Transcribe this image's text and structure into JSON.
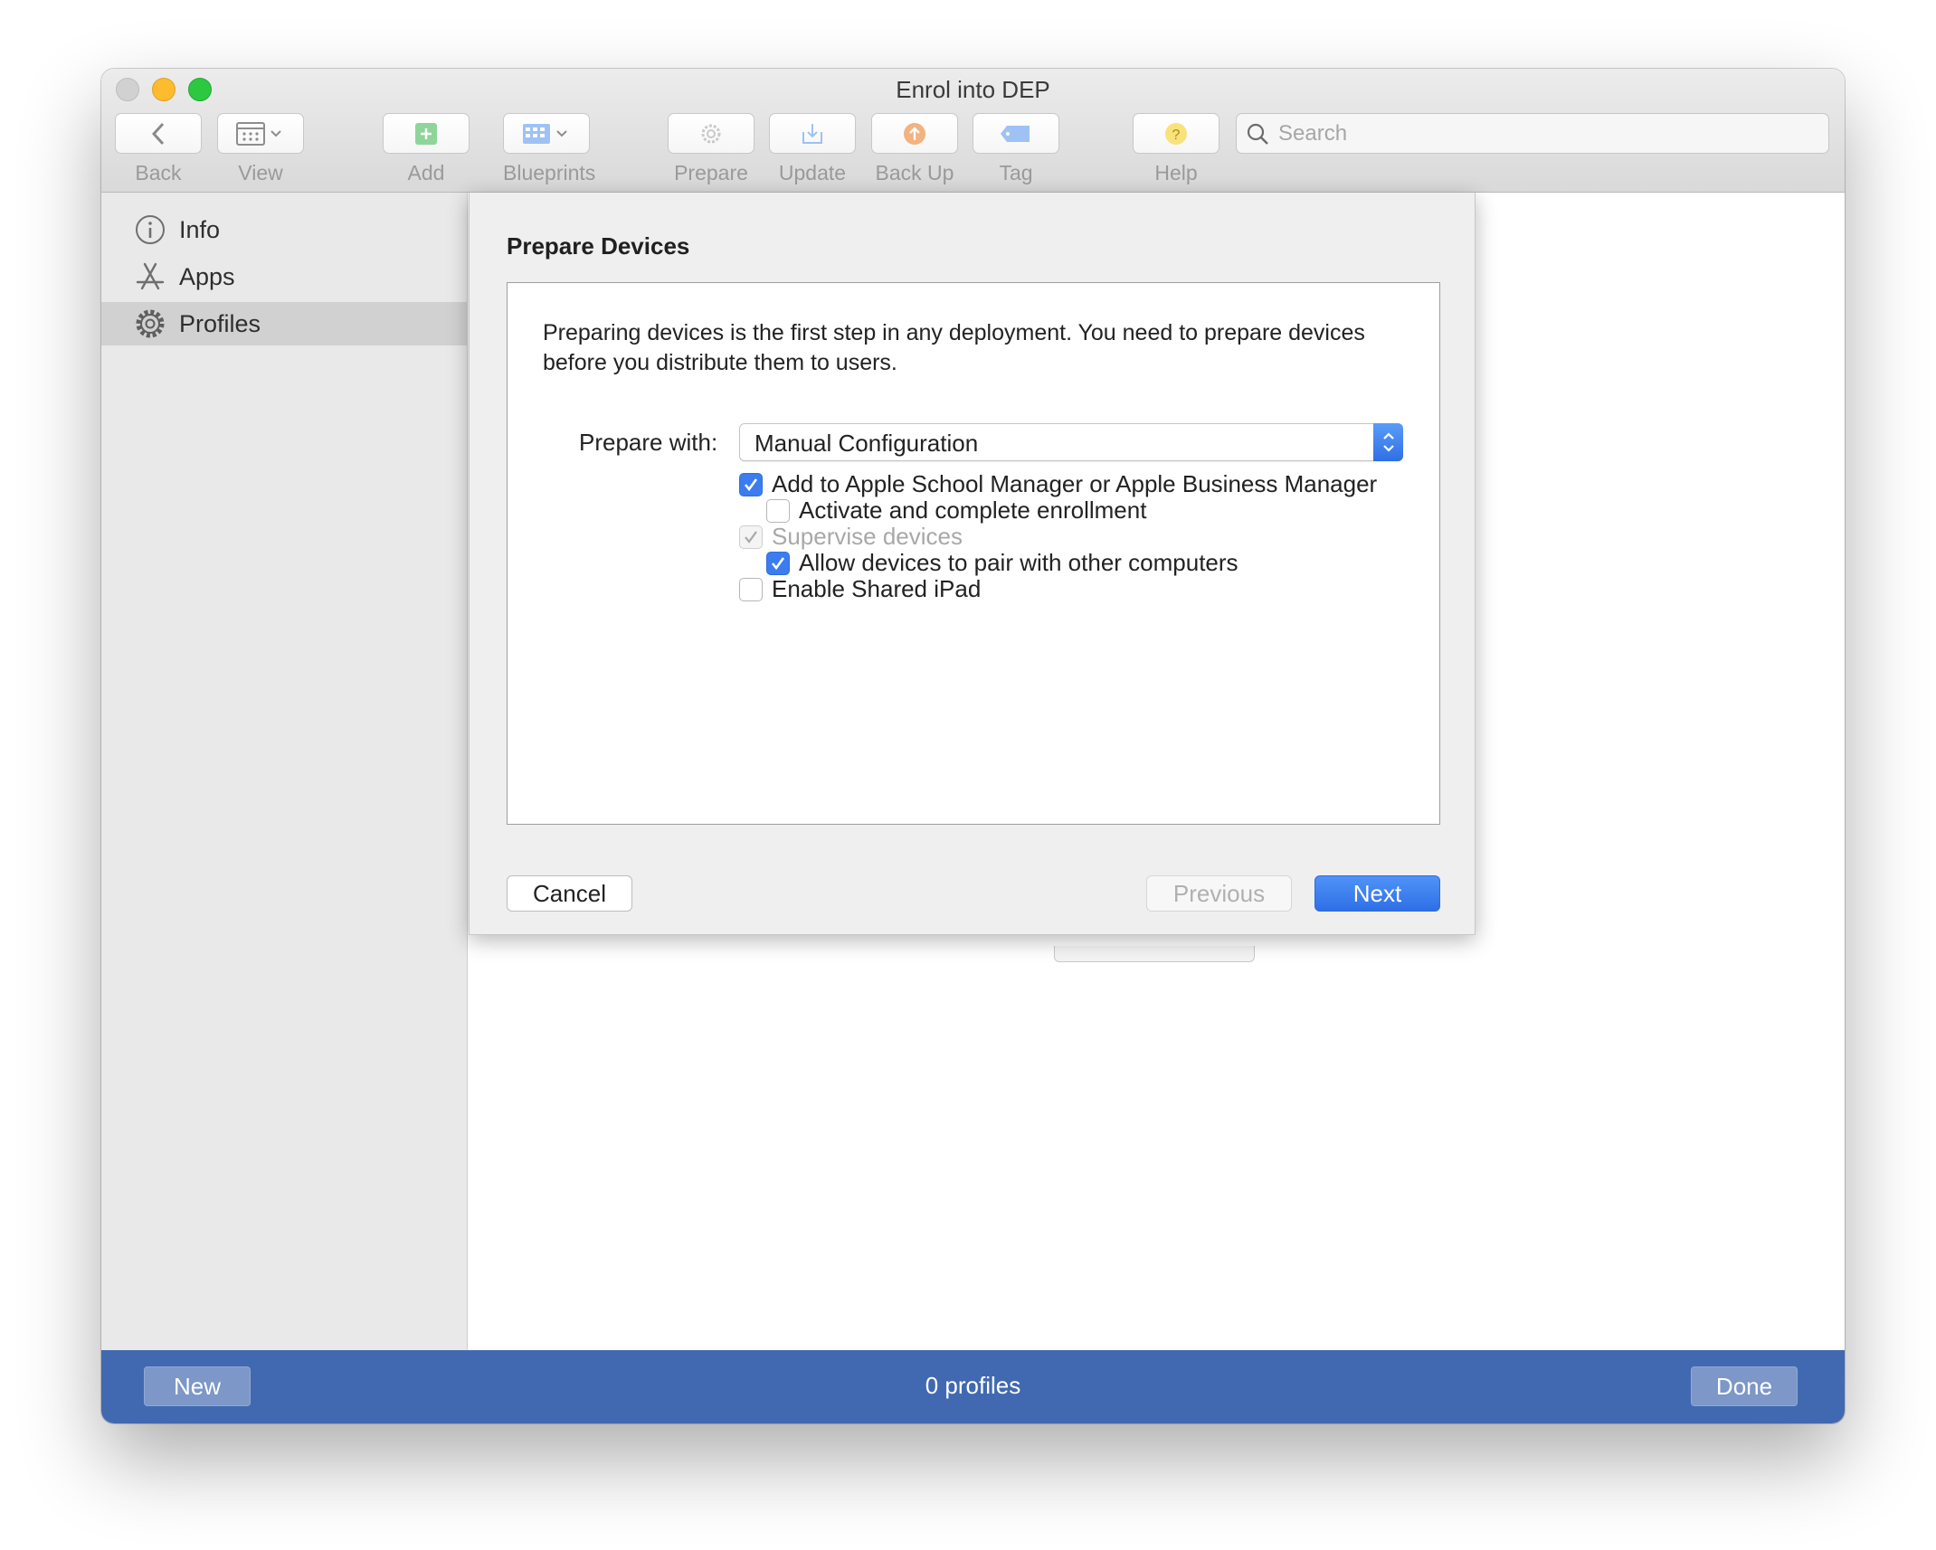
{
  "window": {
    "title": "Enrol into DEP"
  },
  "toolbar": {
    "back": "Back",
    "view": "View",
    "add": "Add",
    "blueprints": "Blueprints",
    "prepare": "Prepare",
    "update": "Update",
    "backup": "Back Up",
    "tag": "Tag",
    "help": "Help",
    "search_placeholder": "Search"
  },
  "sidebar": {
    "items": [
      {
        "label": "Info",
        "icon": "info-icon"
      },
      {
        "label": "Apps",
        "icon": "app-store-icon"
      },
      {
        "label": "Profiles",
        "icon": "gear-icon",
        "selected": true
      }
    ]
  },
  "sheet": {
    "title": "Prepare Devices",
    "description": "Preparing devices is the first step in any deployment. You need to prepare devices before you distribute them to users.",
    "prepare_with_label": "Prepare with:",
    "prepare_with_value": "Manual Configuration",
    "options": [
      {
        "label": "Add to Apple School Manager or Apple Business Manager",
        "checked": true,
        "enabled": true
      },
      {
        "label": "Activate and complete enrollment",
        "checked": false,
        "enabled": true
      },
      {
        "label": "Supervise devices",
        "checked": true,
        "enabled": false
      },
      {
        "label": "Allow devices to pair with other computers",
        "checked": true,
        "enabled": true
      },
      {
        "label": "Enable Shared iPad",
        "checked": false,
        "enabled": true
      }
    ],
    "cancel": "Cancel",
    "previous": "Previous",
    "next": "Next"
  },
  "bottombar": {
    "new": "New",
    "count": "0 profiles",
    "done": "Done"
  },
  "colors": {
    "accent": "#3b7df0",
    "bottom_bar": "#4169b1"
  }
}
